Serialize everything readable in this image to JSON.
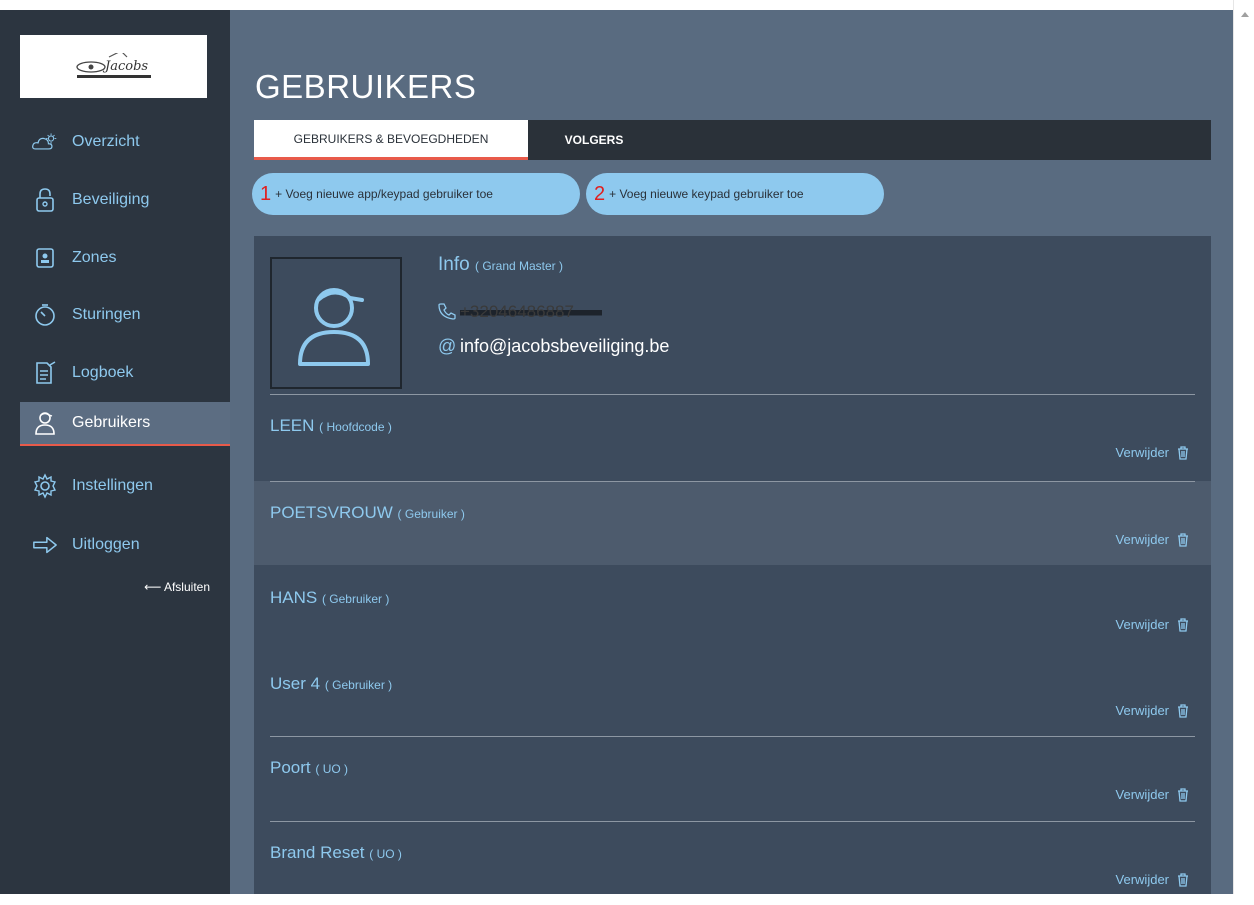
{
  "sidebar": {
    "logo_text": "Jacobs",
    "items": [
      {
        "label": "Overzicht",
        "icon": "cloud-sun-icon"
      },
      {
        "label": "Beveiliging",
        "icon": "lock-icon"
      },
      {
        "label": "Zones",
        "icon": "zone-icon"
      },
      {
        "label": "Sturingen",
        "icon": "timer-icon"
      },
      {
        "label": "Logboek",
        "icon": "logbook-icon"
      },
      {
        "label": "Gebruikers",
        "icon": "user-icon",
        "active": true
      },
      {
        "label": "Instellingen",
        "icon": "gear-icon"
      },
      {
        "label": "Uitloggen",
        "icon": "logout-arrow-icon"
      }
    ],
    "close_label": "⟵ Afsluiten"
  },
  "main": {
    "title": "GEBRUIKERS",
    "tabs": [
      {
        "label": "GEBRUIKERS & BEVOEGDHEDEN",
        "active": true
      },
      {
        "label": "VOLGERS",
        "active": false
      }
    ],
    "add_buttons": [
      {
        "number": "1",
        "label": "+ Voeg nieuwe app/keypad gebruiker toe"
      },
      {
        "number": "2",
        "label": "+ Voeg nieuwe keypad gebruiker toe"
      }
    ]
  },
  "grand_master": {
    "name": "Info",
    "role": "( Grand Master )",
    "phone": "+32046486887",
    "email": "info@jacobsbeveiliging.be"
  },
  "users": [
    {
      "name": "LEEN",
      "role": "( Hoofdcode )",
      "delete_label": "Verwijder"
    },
    {
      "name": "POETSVROUW",
      "role": "( Gebruiker )",
      "delete_label": "Verwijder"
    },
    {
      "name": "HANS",
      "role": "( Gebruiker )",
      "delete_label": "Verwijder"
    },
    {
      "name": "User 4",
      "role": "( Gebruiker )",
      "delete_label": "Verwijder"
    },
    {
      "name": "Poort",
      "role": "( UO )",
      "delete_label": "Verwijder"
    },
    {
      "name": "Brand Reset",
      "role": "( UO )",
      "delete_label": "Verwijder"
    }
  ],
  "colors": {
    "sidebar_bg": "#2c3540",
    "main_bg": "#596b80",
    "panel_bg": "#3d4b5d",
    "accent_blue": "#8ec9ee",
    "accent_red": "#e85a4a"
  }
}
